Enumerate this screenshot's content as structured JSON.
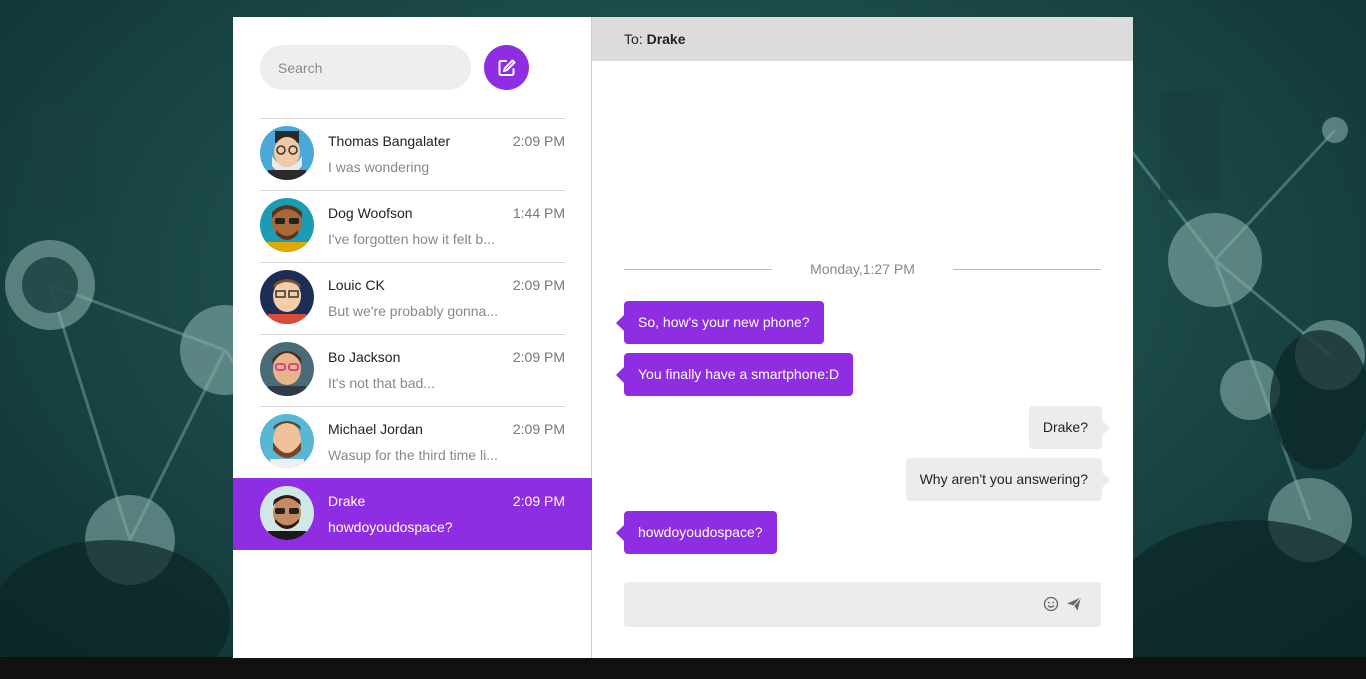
{
  "theme": {
    "accent": "#8e2de2"
  },
  "sidebar": {
    "search_placeholder": "Search",
    "compose_icon": "pencil-square-icon",
    "conversations": [
      {
        "name": "Thomas Bangalater",
        "time": "2:09 PM",
        "preview": "I was wondering"
      },
      {
        "name": "Dog Woofson",
        "time": "1:44 PM",
        "preview": "I've forgotten how it felt b..."
      },
      {
        "name": "Louic CK",
        "time": "2:09 PM",
        "preview": "But we're probably gonna..."
      },
      {
        "name": "Bo Jackson",
        "time": "2:09 PM",
        "preview": "It's not that bad..."
      },
      {
        "name": "Michael Jordan",
        "time": "2:09 PM",
        "preview": "Wasup for the third time li..."
      },
      {
        "name": "Drake",
        "time": "2:09 PM",
        "preview": "howdoyoudospace?"
      }
    ],
    "active_index": 5
  },
  "chat": {
    "to_label": "To:",
    "to_name": "Drake",
    "date_divider": "Monday,1:27 PM",
    "messages": [
      {
        "from": "them",
        "text": "So, how's your new phone?"
      },
      {
        "from": "them",
        "text": "You finally have a smartphone:D"
      },
      {
        "from": "me",
        "text": "Drake?"
      },
      {
        "from": "me",
        "text": "Why aren't you answering?"
      },
      {
        "from": "them",
        "text": "howdoyoudospace?"
      }
    ],
    "composer": {
      "value": "",
      "emoji_icon": "smiley-icon",
      "send_icon": "paper-plane-icon"
    }
  }
}
